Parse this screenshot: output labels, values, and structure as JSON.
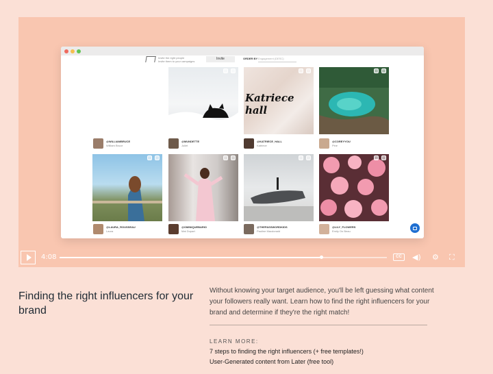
{
  "video": {
    "time": "4:08",
    "progress": 0.8,
    "cc_label": "CC",
    "icons": {
      "play": "play-icon",
      "volume": "volume-icon",
      "settings": "gear-icon",
      "fullscreen": "fullscreen-icon"
    },
    "colors": {
      "background": "#f9c6b0",
      "accent": "#1f6fd1"
    }
  },
  "app": {
    "invite_line1": "Invite the right people",
    "invite_line2": "Invite them to your campaigns",
    "invite_button": "Invite",
    "order_label": "ORDER BY",
    "order_value": "Engagement (DESC)",
    "tiles": [
      {
        "handle": "@WILLIAMBRUCE",
        "name": "William Bruce",
        "image": "blank"
      },
      {
        "handle": "@MUNDETTE",
        "name": "Juliet",
        "image": "black-cat-in-snow"
      },
      {
        "handle": "@KATRIECE_HALL",
        "name": "Katriece",
        "image": "katriece-hall-script",
        "script": "Katriece hall"
      },
      {
        "handle": "@COREYYOU",
        "name": "Pine",
        "image": "turquoise-cove"
      },
      {
        "handle": "@LAURA_ROUSSEAU",
        "name": "Laura",
        "image": "girl-city-view"
      },
      {
        "handle": "@OMINIQUEBARIO",
        "name": "Mat Dupart",
        "image": "woman-in-pink"
      },
      {
        "handle": "@THEPASSWORDKIDS",
        "name": "Pauline Macdonald",
        "image": "plane-wreck"
      },
      {
        "handle": "@LILY_FLOWERS",
        "name": "Emily On Beau",
        "image": "pink-flowers"
      }
    ]
  },
  "content": {
    "heading": "Finding the right influencers for your brand",
    "description": "Without knowing your target audience, you'll be left guessing what content your followers really want. Learn how to find the right influencers for your brand and determine if they're the right match!",
    "learn_more": "LEARN MORE:",
    "links": [
      "7 steps to finding the right influencers (+ free templates!)",
      "User-Generated content from Later (free tool)"
    ]
  }
}
